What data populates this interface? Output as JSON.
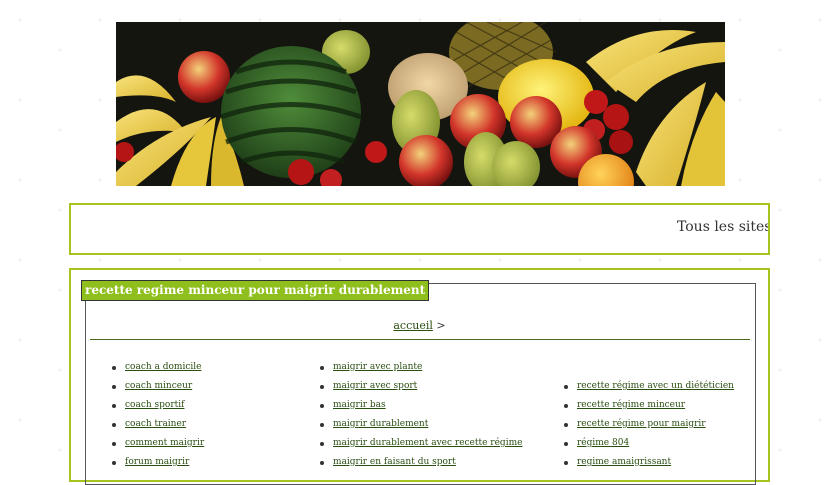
{
  "ticker": {
    "text": "Tous les sites"
  },
  "section": {
    "title": "recette regime minceur pour maigrir durablement"
  },
  "breadcrumb": {
    "home_label": "accueil",
    "separator": ">"
  },
  "links": {
    "col1": [
      "coach a domicile",
      "coach minceur",
      "coach sportif",
      "coach trainer",
      "comment maigrir",
      "forum maigrir"
    ],
    "col2": [
      "maigrir avec plante",
      "maigrir avec sport",
      "maigrir bas",
      "maigrir durablement",
      "maigrir durablement avec recette régime",
      "maigrir en faisant du sport"
    ],
    "col3": [
      "recette régime avec un diététicien",
      "recette régime minceur",
      "recette régime pour maigrir",
      "régime 804",
      "regime amaigrissant"
    ]
  },
  "colors": {
    "accent_border": "#a6c41e",
    "tag_bg": "#8fbf1c",
    "link": "#2a4f12"
  }
}
